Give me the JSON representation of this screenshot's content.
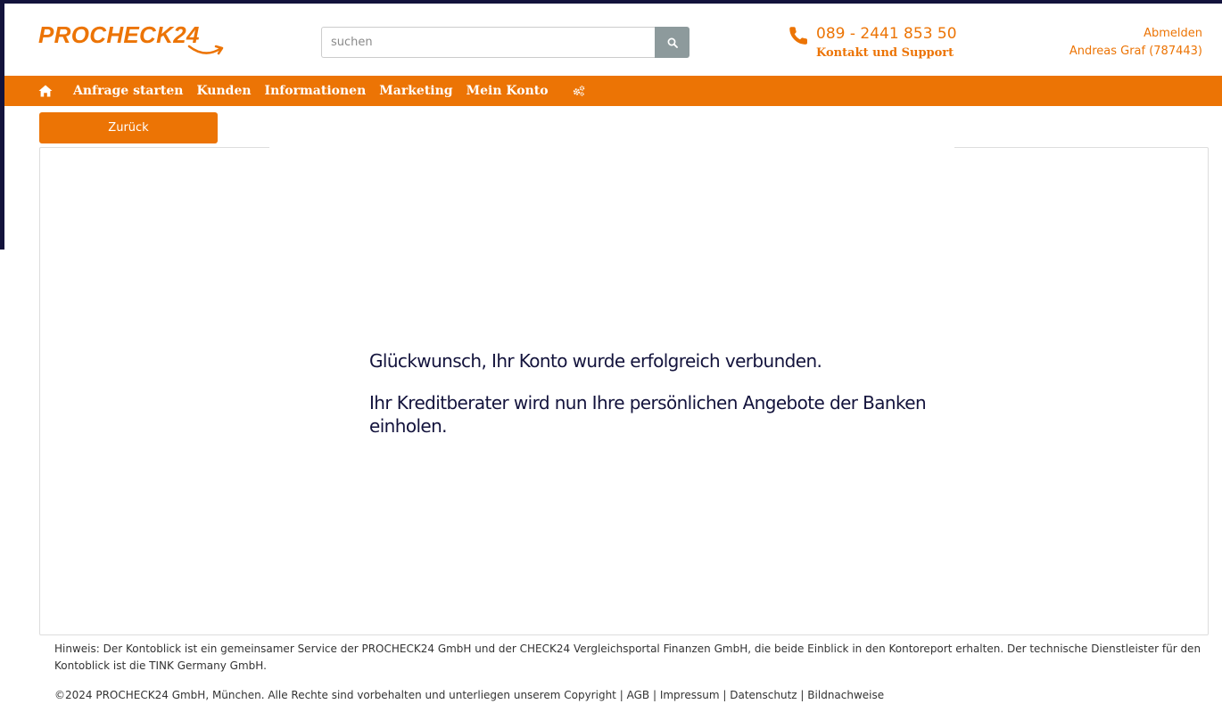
{
  "colors": {
    "brand_orange": "#ec7405",
    "dark_navy": "#13133c",
    "search_button_gray": "#8d9a9c"
  },
  "header": {
    "logo_text": "PROCHECK24",
    "search": {
      "placeholder": "suchen",
      "value": "",
      "button_icon": "search-icon"
    },
    "contact": {
      "phone_icon": "phone-icon",
      "phone_number": "089 - 2441 853 50",
      "support_label": "Kontakt und Support"
    },
    "account": {
      "logout_label": "Abmelden",
      "user_name": "Andreas Graf (787443)"
    }
  },
  "nav": {
    "home_icon": "home-icon",
    "items": [
      {
        "label": "Anfrage starten"
      },
      {
        "label": "Kunden"
      },
      {
        "label": "Informationen"
      },
      {
        "label": "Marketing"
      },
      {
        "label": "Mein Konto"
      }
    ],
    "settings_icon": "gears-icon"
  },
  "actions": {
    "back_label": "Zurück"
  },
  "main": {
    "success_message": "Glückwunsch, Ihr Konto wurde erfolgreich verbunden.",
    "followup_message": "Ihr Kreditberater wird nun Ihre persönlichen Angebote der Banken einholen."
  },
  "footer": {
    "notice": "Hinweis: Der Kontoblick ist ein gemeinsamer Service der PROCHECK24 GmbH und der CHECK24 Vergleichsportal Finanzen GmbH, die beide Einblick in den Kontoreport erhalten. Der technische Dienstleister für den Kontoblick ist die TINK Germany GmbH.",
    "copyright": "©2024 PROCHECK24 GmbH, München. Alle Rechte sind vorbehalten und unterliegen unserem Copyright",
    "separator": "|",
    "links": [
      {
        "label": "AGB"
      },
      {
        "label": "Impressum"
      },
      {
        "label": "Datenschutz"
      },
      {
        "label": "Bildnachweise"
      }
    ]
  }
}
